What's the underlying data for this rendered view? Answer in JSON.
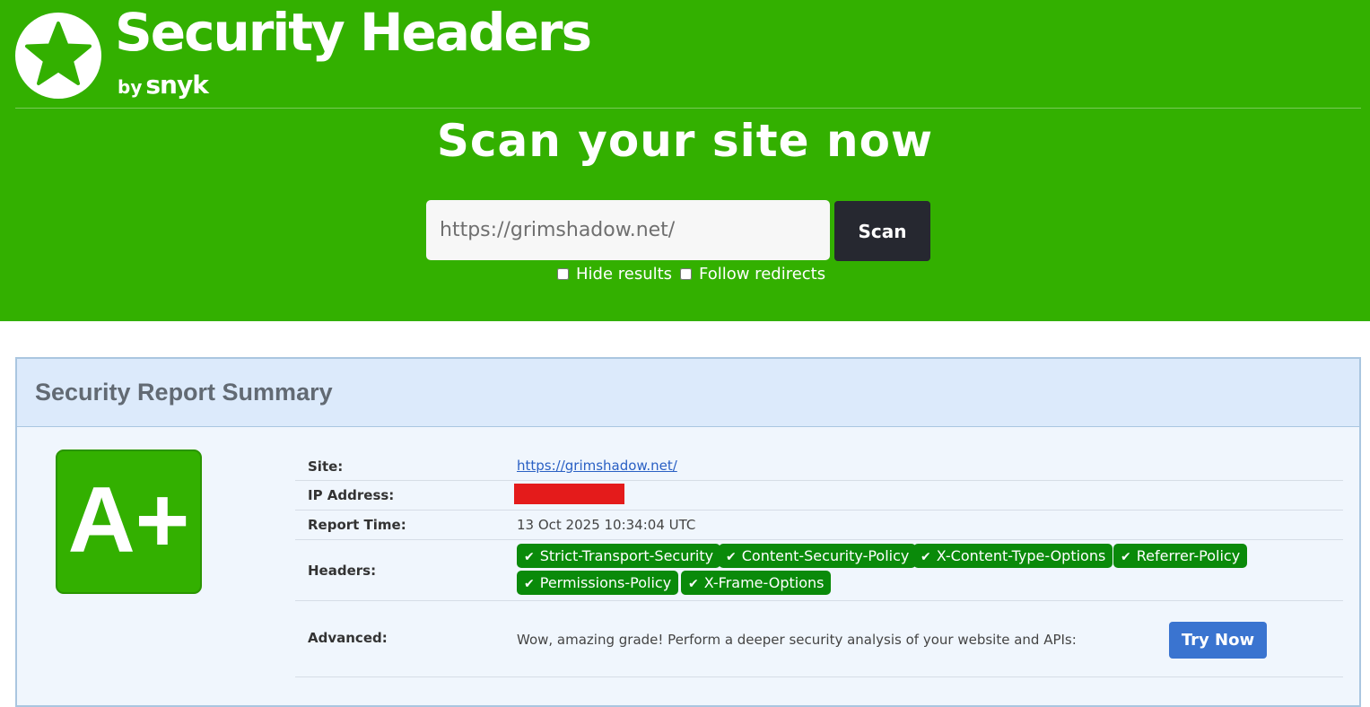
{
  "brand": {
    "title": "Security Headers",
    "by": "by",
    "company": "snyk",
    "logo_icon": "star-icon"
  },
  "scan": {
    "heading": "Scan your site now",
    "input_placeholder": "https://grimshadow.net/",
    "input_value": "",
    "button_label": "Scan",
    "options": [
      {
        "label": "Hide results",
        "checked": false
      },
      {
        "label": "Follow redirects",
        "checked": false
      }
    ]
  },
  "report": {
    "title": "Security Report Summary",
    "grade": "A+",
    "grade_color": "#33b000",
    "site_label": "Site:",
    "site_value": "https://grimshadow.net/",
    "ip_label": "IP Address:",
    "time_label": "Report Time:",
    "time_value": "13 Oct 2025 10:34:04 UTC",
    "headers_label": "Headers:",
    "headers": [
      "Strict-Transport-Security",
      "Content-Security-Policy",
      "X-Content-Type-Options",
      "Referrer-Policy",
      "Permissions-Policy",
      "X-Frame-Options"
    ],
    "header_icon": "check-icon",
    "advanced_label": "Advanced:",
    "advanced_text": "Wow, amazing grade! Perform a deeper security analysis of your website and APIs:",
    "try_button": "Try Now"
  },
  "colors": {
    "hero_green": "#33b000",
    "badge_green": "#0a8a0a",
    "scan_button": "#262830",
    "try_button": "#3a74d0",
    "redaction": "#e41b1b"
  }
}
